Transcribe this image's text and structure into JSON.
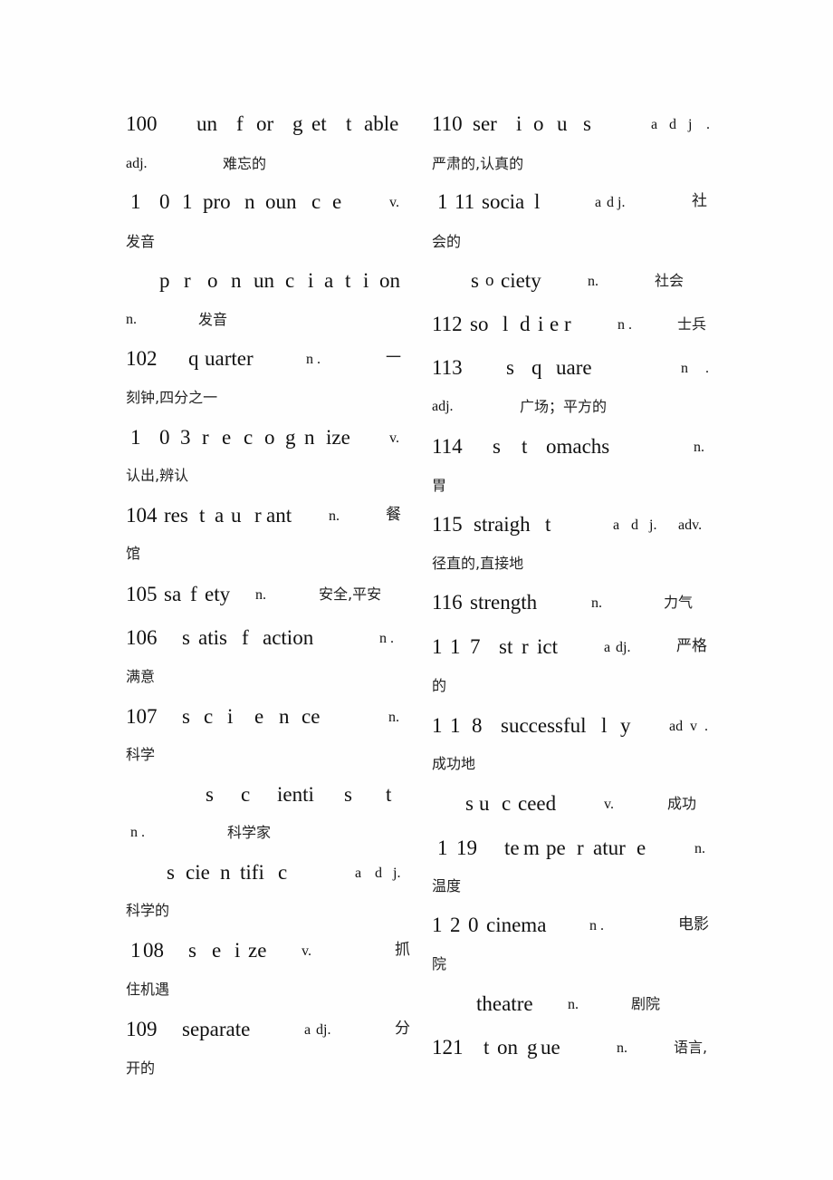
{
  "document": {
    "left_column": [
      {
        "id": "100",
        "lines": [
          [
            "100",
            "un",
            "f",
            "or",
            "g",
            "et",
            "t",
            "able"
          ],
          [
            "adj.",
            "难忘的"
          ]
        ]
      },
      {
        "id": "101",
        "lines": [
          [
            "1",
            "0",
            "1",
            "pro",
            "n",
            "oun",
            "c",
            "e",
            "v."
          ],
          [
            "发音"
          ]
        ]
      },
      {
        "id": "101b",
        "lines": [
          [
            "p",
            "r",
            "o",
            "n",
            "un",
            "c",
            "i",
            "a",
            "t",
            "i",
            "on"
          ],
          [
            "n.",
            "发音"
          ]
        ]
      },
      {
        "id": "102",
        "lines": [
          [
            "102",
            "q",
            "uarter",
            "n .",
            "一"
          ],
          [
            "刻钟,四分之一"
          ]
        ]
      },
      {
        "id": "103",
        "lines": [
          [
            "1",
            "0",
            "3",
            "r",
            "e",
            "c",
            "o",
            "g",
            "n",
            "ize",
            "v."
          ],
          [
            "认出,辨认"
          ]
        ]
      },
      {
        "id": "104",
        "lines": [
          [
            "104",
            "res",
            "t",
            "a",
            "u",
            "r",
            "ant",
            "n.",
            "餐"
          ],
          [
            "馆"
          ]
        ]
      },
      {
        "id": "105",
        "lines": [
          [
            "105",
            "sa",
            "f",
            "ety",
            "n.",
            "安全,平安"
          ]
        ]
      },
      {
        "id": "106",
        "lines": [
          [
            "106",
            "s",
            "atis",
            "f",
            "action",
            "n ."
          ],
          [
            "满意"
          ]
        ]
      },
      {
        "id": "107",
        "lines": [
          [
            "107",
            "s",
            "c",
            "i",
            "e",
            "n",
            "ce",
            "n."
          ],
          [
            "科学"
          ]
        ]
      },
      {
        "id": "107b",
        "lines": [
          [
            "s",
            "c",
            "ienti",
            "s",
            "t"
          ],
          [
            "n .",
            "科学家"
          ]
        ]
      },
      {
        "id": "107c",
        "lines": [
          [
            "s",
            "cie",
            "n",
            "tifi",
            "c",
            "a",
            "d",
            "j."
          ],
          [
            "科学的"
          ]
        ]
      },
      {
        "id": "108",
        "lines": [
          [
            "1",
            "08",
            "s",
            "e",
            "i",
            "ze",
            "v.",
            "抓"
          ],
          [
            "住机遇"
          ]
        ]
      },
      {
        "id": "109",
        "lines": [
          [
            "109",
            "separate",
            "a",
            "dj.",
            "分"
          ],
          [
            "开的"
          ]
        ]
      }
    ],
    "right_column": [
      {
        "id": "110",
        "lines": [
          [
            "110",
            "ser",
            "i",
            "o",
            "u",
            "s",
            "a",
            "d",
            "j",
            "."
          ],
          [
            "严肃的,认真的"
          ]
        ]
      },
      {
        "id": "111",
        "lines": [
          [
            "1",
            "11",
            "socia",
            "l",
            "a",
            "d",
            "j.",
            "社"
          ],
          [
            "会的"
          ]
        ]
      },
      {
        "id": "111b",
        "lines": [
          [
            "s",
            "o",
            "ciety",
            "n.",
            "社会"
          ]
        ]
      },
      {
        "id": "112",
        "lines": [
          [
            "112",
            "so",
            "l",
            "d",
            "i",
            "e",
            "r",
            "n .",
            "士兵"
          ]
        ]
      },
      {
        "id": "113",
        "lines": [
          [
            "113",
            "s",
            "q",
            "uare",
            "n",
            "."
          ],
          [
            "adj.",
            "广场；平方的"
          ]
        ]
      },
      {
        "id": "114",
        "lines": [
          [
            "114",
            "s",
            "t",
            "omachs",
            "n."
          ],
          [
            "胃"
          ]
        ]
      },
      {
        "id": "115",
        "lines": [
          [
            "115",
            "straigh",
            "t",
            "a",
            "d",
            "j.",
            "adv."
          ],
          [
            "径直的,直接地"
          ]
        ]
      },
      {
        "id": "116",
        "lines": [
          [
            "116",
            "strength",
            "n.",
            "力气"
          ]
        ]
      },
      {
        "id": "117",
        "lines": [
          [
            "1",
            "1",
            "7",
            "st",
            "r",
            "ict",
            "a",
            "dj.",
            "严格"
          ],
          [
            "的"
          ]
        ]
      },
      {
        "id": "118",
        "lines": [
          [
            "1",
            "1",
            "8",
            "successful",
            "l",
            "y",
            "ad",
            "v",
            "."
          ],
          [
            "成功地"
          ]
        ]
      },
      {
        "id": "118b",
        "lines": [
          [
            "s",
            "u",
            "c",
            "ceed",
            "v.",
            "成功"
          ]
        ]
      },
      {
        "id": "119",
        "lines": [
          [
            "1",
            "19",
            "te",
            "m",
            "pe",
            "r",
            "atur",
            "e",
            "n."
          ],
          [
            "温度"
          ]
        ]
      },
      {
        "id": "120",
        "lines": [
          [
            "1",
            "2",
            "0",
            "cinema",
            "n .",
            "电影"
          ],
          [
            "院"
          ]
        ]
      },
      {
        "id": "120b",
        "lines": [
          [
            "theatre",
            "n.",
            "剧院"
          ]
        ]
      },
      {
        "id": "121",
        "lines": [
          [
            "121",
            "t",
            "on",
            "g",
            "ue",
            "n.",
            "语言,"
          ]
        ]
      }
    ]
  }
}
